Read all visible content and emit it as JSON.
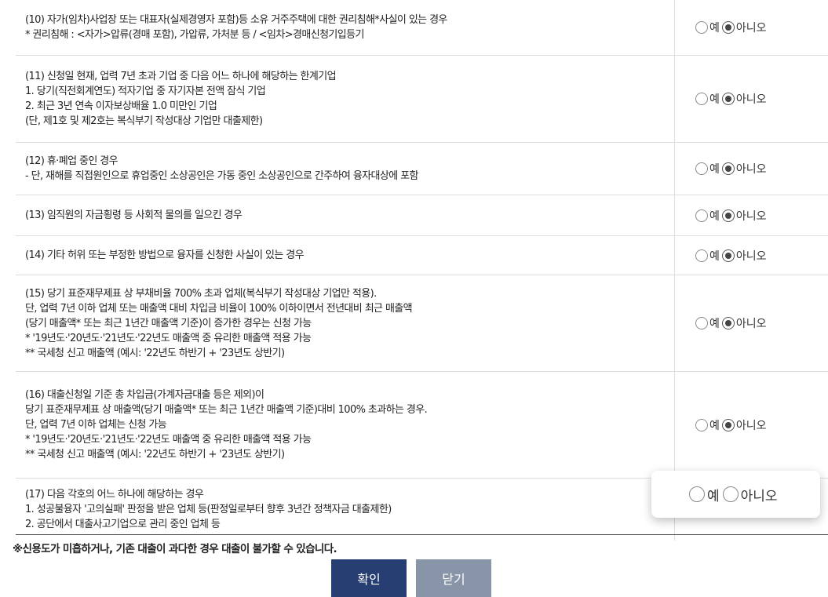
{
  "criteria": [
    {
      "lines": [
        "(10) 자가(임차)사업장 또는 대표자(실제경영자 포함)등 소유 거주주택에 대한 권리침해*사실이 있는 경우",
        " * 권리침해 : <자가>압류(경매 포함), 가압류, 가처분 등 / <임차>경매신청기입등기"
      ],
      "selected": "no"
    },
    {
      "lines": [
        "(11) 신청일 현재, 업력 7년 초과 기업 중 다음 어느 하나에 해당하는 한계기업",
        " 1. 당기(직전회계연도) 적자기업 중 자기자본 전액 잠식 기업",
        " 2. 최근 3년 연속 이자보상배율 1.0 미만인 기업",
        "  (단, 제1호 및 제2호는 복식부기 작성대상 기업만 대출제한)"
      ],
      "selected": "no"
    },
    {
      "lines": [
        "(12) 휴·폐업 중인 경우",
        "- 단, 재해를 직접원인으로 휴업중인 소상공인은 가동 중인 소상공인으로 간주하여 융자대상에 포함"
      ],
      "selected": "no"
    },
    {
      "lines": [
        "(13) 임직원의 자금횡령 등 사회적 물의를 일으킨 경우"
      ],
      "selected": "no"
    },
    {
      "lines": [
        "(14) 기타 허위 또는 부정한 방법으로 융자를 신청한 사실이 있는 경우"
      ],
      "selected": "no"
    },
    {
      "lines": [
        "(15) 당기 표준재무제표 상 부채비율 700% 초과 업체(복식부기 작성대상 기업만 적용).",
        "단, 업력 7년 이하 업체 또는 매출액 대비 차입금 비율이 100% 이하이면서 전년대비 최근 매출액",
        "(당기 매출액* 또는 최근 1년간 매출액 기준)이 증가한 경우는 신청 가능",
        "* '19년도·'20년도·'21년도·'22년도 매출액 중 유리한 매출액 적용 가능",
        "  ** 국세청 신고 매출액 (예시: '22년도 하반기 + '23년도 상반기)"
      ],
      "selected": "no"
    },
    {
      "lines": [
        "(16) 대출신청일 기준 총 차입금(가계자금대출 등은 제외)이",
        "당기 표준재무제표 상 매출액(당기 매출액* 또는 최근 1년간 매출액 기준)대비 100% 초과하는 경우.",
        "단, 업력 7년 이하 업체는 신청 가능",
        "* '19년도·'20년도·'21년도·'22년도 매출액 중 유리한 매출액 적용 가능",
        "  ** 국세청 신고 매출액 (예시: '22년도 하반기 + '23년도 상반기)"
      ],
      "selected": "no"
    },
    {
      "lines": [
        "(17) 다음 각호의 어느 하나에 해당하는 경우",
        " 1. 성공불융자 '고의실패' 판정을 받은 업체 등(판정일로부터 향후 3년간 정책자금 대출제한)",
        " 2. 공단에서 대출사고기업으로 관리 중인 업체 등"
      ],
      "selected": "none"
    }
  ],
  "options": {
    "yes": "예",
    "no": "아니오"
  },
  "notice": "※신용도가 미흡하거나, 기존 대출이 과다한 경우 대출이 불가할 수 있습니다.",
  "buttons": {
    "confirm": "확인",
    "close": "닫기"
  },
  "colors": {
    "confirm_bg": "#263e72",
    "close_bg": "#8895a8"
  }
}
